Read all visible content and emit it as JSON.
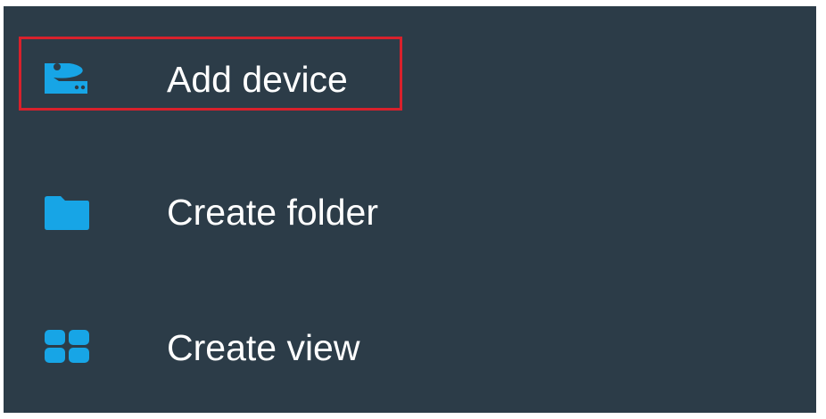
{
  "colors": {
    "panel_background": "#2c3c48",
    "icon_accent": "#17a5e6",
    "label_text": "#ffffff",
    "highlight_border": "#d8212c"
  },
  "menu": {
    "items": [
      {
        "label": "Add device",
        "icon": "camera-device-icon",
        "highlighted": true
      },
      {
        "label": "Create folder",
        "icon": "folder-icon",
        "highlighted": false
      },
      {
        "label": "Create view",
        "icon": "grid-view-icon",
        "highlighted": false
      }
    ]
  }
}
